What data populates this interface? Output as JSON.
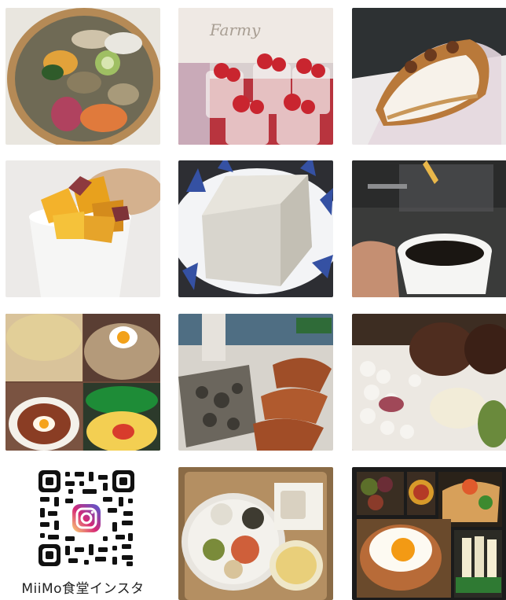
{
  "gallery": {
    "tiles": [
      {
        "icon": "bowl-salad-photo"
      },
      {
        "icon": "strawberry-cups-photo",
        "text": "Farmy"
      },
      {
        "icon": "cream-roll-photo"
      },
      {
        "icon": "sweet-potato-cup-photo"
      },
      {
        "icon": "tofu-block-photo"
      },
      {
        "icon": "coffee-cup-photo"
      },
      {
        "icon": "rice-bowls-collage-photo"
      },
      {
        "icon": "grilled-food-plate-photo"
      },
      {
        "icon": "hamburg-bento-photo"
      },
      {
        "icon": "instagram-qr-code"
      },
      {
        "icon": "tray-lunch-photo"
      },
      {
        "icon": "bento-box-photo"
      }
    ],
    "qr_caption": "MiiMo食堂インスタ"
  },
  "colors": {
    "instagram_gradient_start": "#feda75",
    "instagram_gradient_mid": "#d62976",
    "instagram_gradient_end": "#4f5bd5"
  }
}
